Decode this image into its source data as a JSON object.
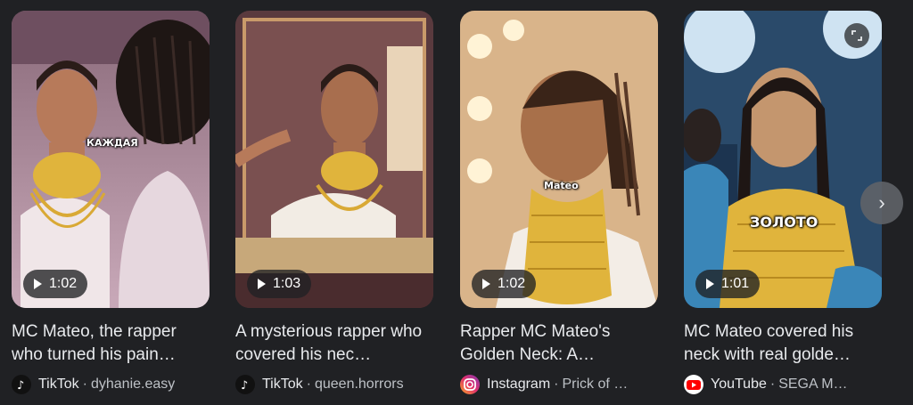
{
  "videos": [
    {
      "duration": "1:02",
      "title": "MC Mateo, the rapper who turned his pain…",
      "source_name": "TikTok",
      "source_handle": "dyhanie.easy",
      "source_icon": "tiktok-icon",
      "overlay_text": "КАЖДАЯ"
    },
    {
      "duration": "1:03",
      "title": "A mysterious rapper who covered his nec…",
      "source_name": "TikTok",
      "source_handle": "queen.horrors",
      "source_icon": "tiktok-icon",
      "overlay_text": ""
    },
    {
      "duration": "1:02",
      "title": "Rapper MC Mateo's Golden Neck: A…",
      "source_name": "Instagram",
      "source_handle": "Prick of …",
      "source_icon": "instagram-icon",
      "overlay_text": "Mateo"
    },
    {
      "duration": "1:01",
      "title": "MC Mateo covered his neck with real golde…",
      "source_name": "YouTube",
      "source_handle": "SEGA M…",
      "source_icon": "youtube-icon",
      "overlay_text": "ЗОЛОТО"
    }
  ],
  "separator": "·",
  "controls": {
    "expand_icon": "expand-icon",
    "next_icon": "chevron-right-icon",
    "next_glyph": "›"
  },
  "colors": {
    "background": "#202124",
    "text_primary": "#e8eaed",
    "text_secondary": "#bdc1c6",
    "youtube_red": "#ff0000",
    "gold": "#e0b43c"
  }
}
